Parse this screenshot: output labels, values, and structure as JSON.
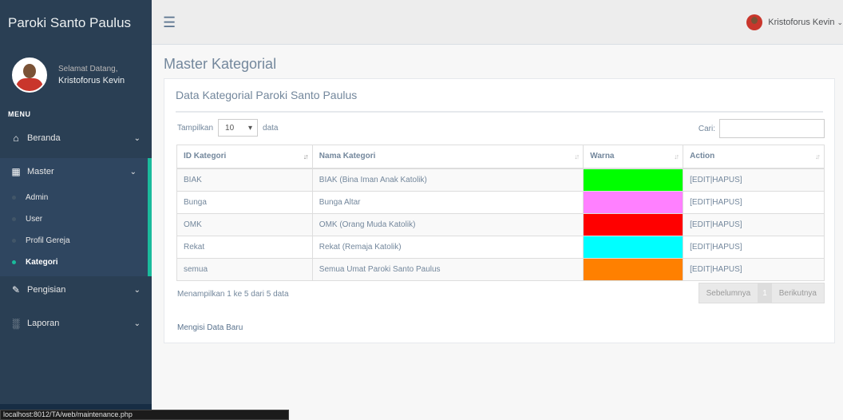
{
  "sidebar": {
    "brand": "Paroki Santo Paulus",
    "welcome": "Selamat Datang,",
    "user_name": "Kristoforus Kevin",
    "menu_title": "MENU",
    "items": [
      {
        "label": "Beranda",
        "icon": "home-icon"
      },
      {
        "label": "Master",
        "icon": "table-icon"
      },
      {
        "label": "Pengisian",
        "icon": "edit-icon"
      },
      {
        "label": "Laporan",
        "icon": "bar-chart-icon"
      }
    ],
    "master_sub": [
      "Admin",
      "User",
      "Profil Gereja",
      "Kategori"
    ],
    "active_sub": "Kategori"
  },
  "topbar": {
    "user": "Kristoforus Kevin"
  },
  "page": {
    "title": "Master Kategorial",
    "panel_title": "Data Kategorial Paroki Santo Paulus",
    "length_prefix": "Tampilkan",
    "length_value": "10",
    "length_suffix": "data",
    "search_label": "Cari:",
    "search_value": "",
    "columns": [
      "ID Kategori",
      "Nama Kategori",
      "Warna",
      "Action"
    ],
    "rows": [
      {
        "id": "BIAK",
        "name": "BIAK (Bina Iman Anak Katolik)",
        "color": "#00FF00",
        "action": "[EDIT|HAPUS]"
      },
      {
        "id": "Bunga",
        "name": "Bunga Altar",
        "color": "#FF80FF",
        "action": "[EDIT|HAPUS]"
      },
      {
        "id": "OMK",
        "name": "OMK (Orang Muda Katolik)",
        "color": "#FF0000",
        "action": "[EDIT|HAPUS]"
      },
      {
        "id": "Rekat",
        "name": "Rekat (Remaja Katolik)",
        "color": "#00FFFF",
        "action": "[EDIT|HAPUS]"
      },
      {
        "id": "semua",
        "name": "Semua Umat Paroki Santo Paulus",
        "color": "#FF8000",
        "action": "[EDIT|HAPUS]"
      }
    ],
    "info": "Menampilkan 1 ke 5 dari 5 data",
    "prev": "Sebelumnya",
    "page_num": "1",
    "next": "Berikutnya",
    "add_new": "Mengisi Data Baru"
  },
  "status_bar_url": "localhost:8012/TA/web/maintenance.php",
  "colors": {
    "sidebar_bg": "#2A3F54",
    "accent": "#1ABB9C"
  }
}
